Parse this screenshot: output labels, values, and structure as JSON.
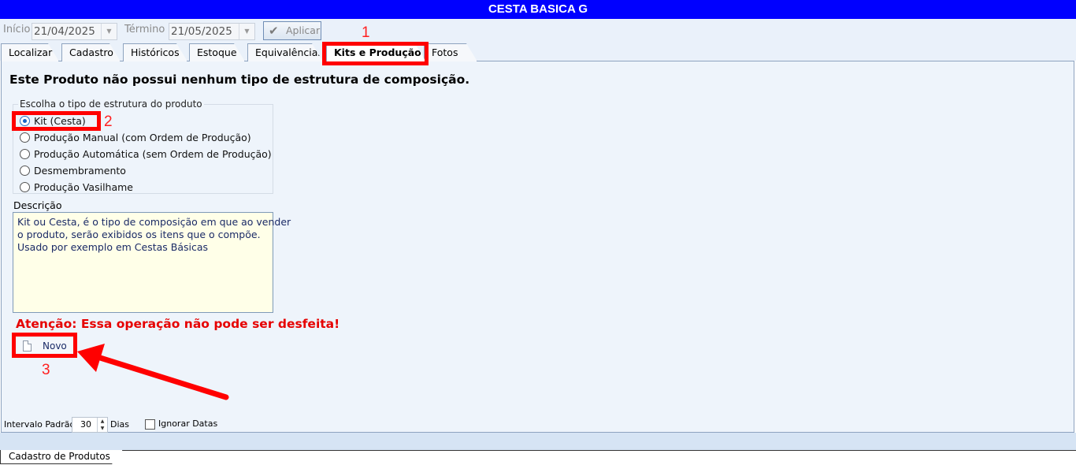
{
  "window": {
    "title": "CESTA BASICA G"
  },
  "toolbar": {
    "inicio_label": "Início",
    "inicio_value": "21/04/2025",
    "termino_label": "Término",
    "termino_value": "21/05/2025",
    "aplicar_label": "Aplicar"
  },
  "tabs": [
    {
      "label": "Localizar"
    },
    {
      "label": "Cadastro"
    },
    {
      "label": "Históricos"
    },
    {
      "label": "Estoque"
    },
    {
      "label": "Equivalências"
    },
    {
      "label": "Kits e Produção",
      "active": true
    },
    {
      "label": "Fotos"
    }
  ],
  "annotations": {
    "n1": "1",
    "n2": "2",
    "n3": "3",
    "color": "#ff0000"
  },
  "panel": {
    "title": "Este Produto não possui nenhum tipo de estrutura de composição.",
    "group_legend": "Escolha o tipo de estrutura do produto",
    "options": [
      {
        "label": "Kit (Cesta)",
        "selected": true
      },
      {
        "label": "Produção Manual (com Ordem de Produção)",
        "selected": false
      },
      {
        "label": "Produção Automática (sem Ordem de Produção)",
        "selected": false
      },
      {
        "label": "Desmembramento",
        "selected": false
      },
      {
        "label": "Produção Vasilhame",
        "selected": false
      }
    ],
    "descricao_label": "Descrição",
    "descricao_lines": [
      "Kit ou Cesta, é o tipo de composição em que ao vender",
      "o produto, serão exibidos os itens que o compõe.",
      "Usado por exemplo em Cestas Básicas"
    ],
    "warning": "Atenção: Essa operação não pode ser desfeita!",
    "novo_label": "Novo"
  },
  "bottom": {
    "intervalo_label": "Intervalo Padrão",
    "intervalo_value": "30",
    "dias_label": "Dias",
    "ignorar_label": "Ignorar Datas",
    "ignorar_checked": false
  },
  "bottom_tab": {
    "label": "Cadastro de Produtos"
  },
  "colors": {
    "titlebar": "#0000ff",
    "warning": "#e60000",
    "panel_bg": "#eef4fb"
  }
}
